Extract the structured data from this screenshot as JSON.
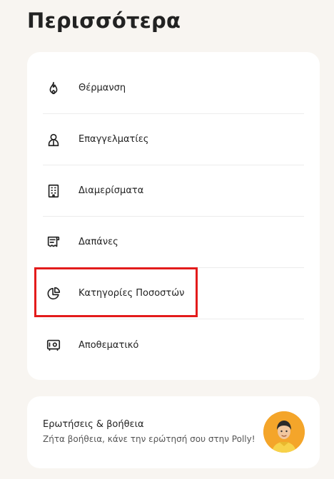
{
  "page": {
    "title": "Περισσότερα"
  },
  "menu": {
    "items": [
      {
        "label": "Θέρμανση",
        "icon": "flame-icon"
      },
      {
        "label": "Επαγγελματίες",
        "icon": "worker-icon"
      },
      {
        "label": "Διαμερίσματα",
        "icon": "building-icon"
      },
      {
        "label": "Δαπάνες",
        "icon": "receipt-icon"
      },
      {
        "label": "Κατηγορίες Ποσοστών",
        "icon": "pie-chart-icon"
      },
      {
        "label": "Αποθεματικό",
        "icon": "safe-icon"
      }
    ]
  },
  "help": {
    "title": "Ερωτήσεις & βοήθεια",
    "subtitle": "Ζήτα βοήθεια, κάνε την ερώτησή σου στην Polly!",
    "avatar_icon": "polly-avatar"
  },
  "colors": {
    "highlight": "#e31b1b",
    "avatar_bg": "#f4a52a"
  }
}
